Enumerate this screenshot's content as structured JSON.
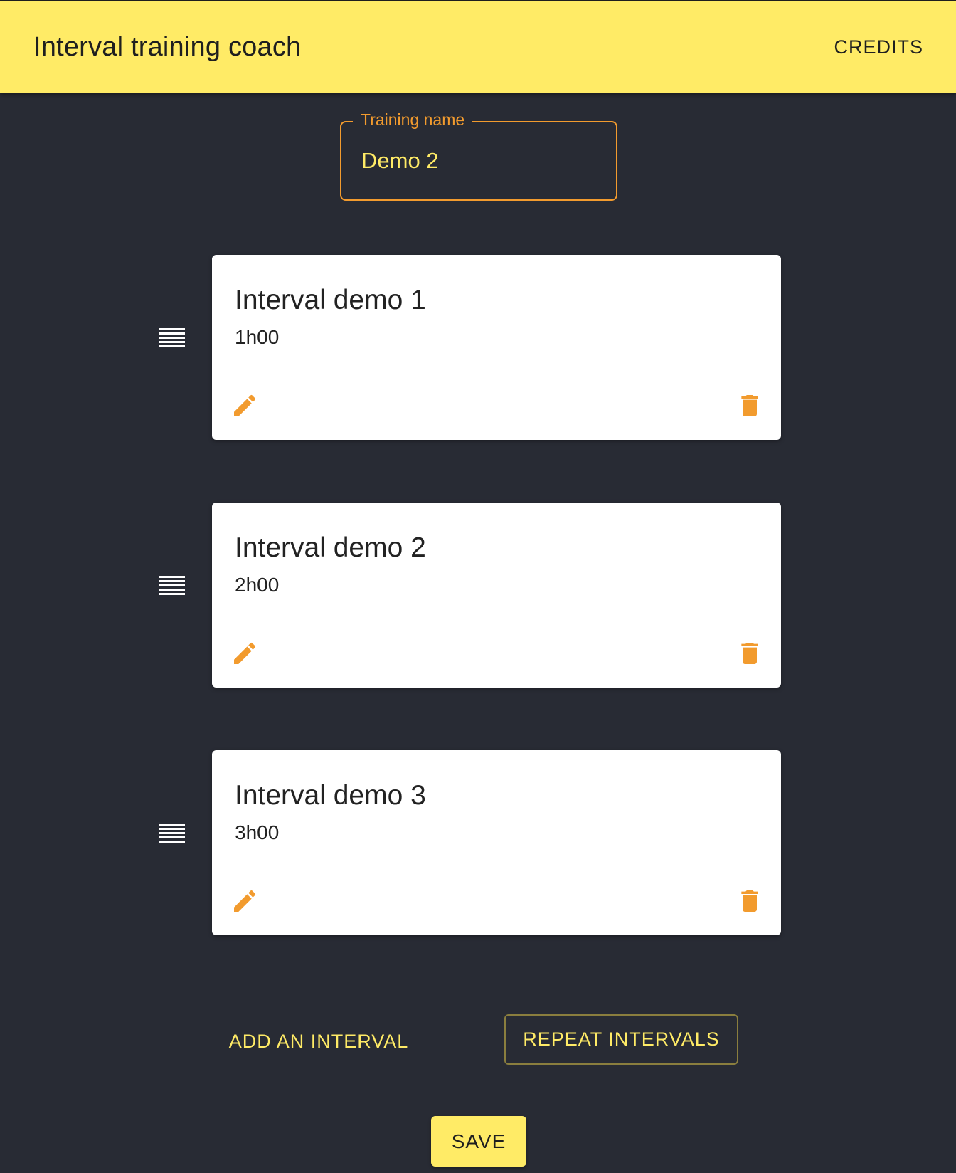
{
  "header": {
    "title": "Interval training coach",
    "credits_label": "CREDITS"
  },
  "training": {
    "name_label": "Training name",
    "name_value": "Demo 2"
  },
  "intervals": [
    {
      "title": "Interval demo 1",
      "duration": "1h00"
    },
    {
      "title": "Interval demo 2",
      "duration": "2h00"
    },
    {
      "title": "Interval demo 3",
      "duration": "3h00"
    }
  ],
  "actions": {
    "add_label": "ADD AN INTERVAL",
    "repeat_label": "REPEAT INTERVALS",
    "save_label": "SAVE"
  },
  "icons": {
    "drag": "drag-handle-icon",
    "edit": "pencil-icon",
    "delete": "trash-icon"
  },
  "colors": {
    "appbar": "#ffeb66",
    "background": "#282b34",
    "accent_orange": "#f29b2e",
    "accent_yellow": "#ffeb66",
    "card": "#ffffff"
  }
}
